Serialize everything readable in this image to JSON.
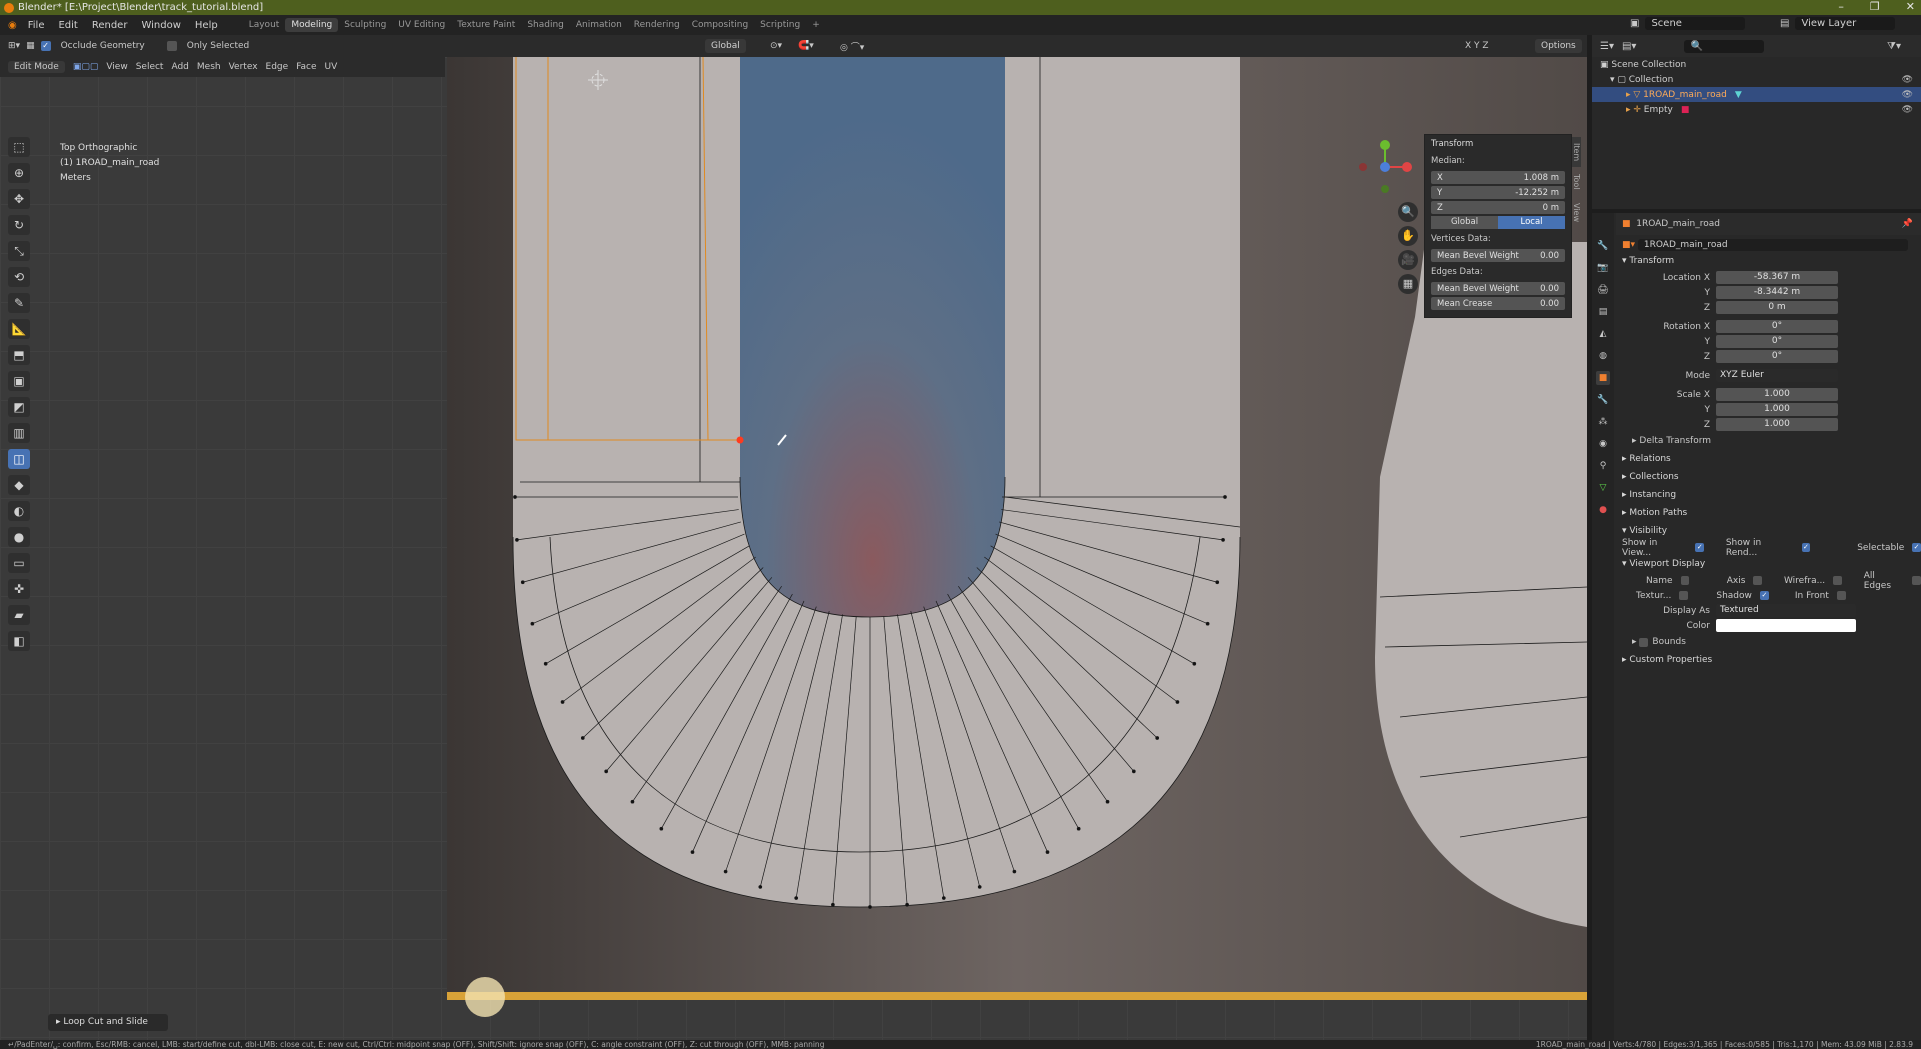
{
  "titlebar": {
    "title": "Blender* [E:\\Project\\Blender\\track_tutorial.blend]",
    "min": "–",
    "max": "❐",
    "close": "✕"
  },
  "menu": {
    "items": [
      "File",
      "Edit",
      "Render",
      "Window",
      "Help"
    ],
    "workspaces": [
      "Layout",
      "Modeling",
      "Sculpting",
      "UV Editing",
      "Texture Paint",
      "Shading",
      "Animation",
      "Rendering",
      "Compositing",
      "Scripting"
    ],
    "active_workspace": "Modeling",
    "add": "+",
    "scene": "Scene",
    "view_layer": "View Layer"
  },
  "header": {
    "occlude": "Occlude Geometry",
    "only_selected": "Only Selected",
    "orientation": "Global",
    "options": "Options",
    "xyz": "X Y Z"
  },
  "header2": {
    "mode": "Edit Mode",
    "items": [
      "View",
      "Select",
      "Add",
      "Mesh",
      "Vertex",
      "Edge",
      "Face",
      "UV"
    ]
  },
  "viewport": {
    "view": "Top Orthographic",
    "object": "(1) 1ROAD_main_road",
    "units": "Meters"
  },
  "npanel": {
    "title": "Transform",
    "median": "Median:",
    "x_label": "X",
    "x": "1.008 m",
    "y_label": "Y",
    "y": "-12.252 m",
    "z_label": "Z",
    "z": "0 m",
    "global": "Global",
    "local": "Local",
    "vertices_data": "Vertices Data:",
    "v_bevel_label": "Mean Bevel Weight",
    "v_bevel": "0.00",
    "edges_data": "Edges Data:",
    "e_bevel_label": "Mean Bevel Weight",
    "e_bevel": "0.00",
    "crease_label": "Mean Crease",
    "crease": "0.00",
    "tabs": [
      "Item",
      "Tool",
      "View"
    ]
  },
  "last_operator": "Loop Cut and Slide",
  "statusbar": {
    "left": "↵/PadEnter/␣: confirm, Esc/RMB: cancel, LMB: start/define cut, dbl-LMB: close cut, E: new cut, Ctrl/Ctrl: midpoint snap (OFF), Shift/Shift: ignore snap (OFF), C: angle constraint (OFF), Z: cut through (OFF), MMB: panning",
    "right": "1ROAD_main_road | Verts:4/780 | Edges:3/1,365 | Faces:0/585 | Tris:1,170 | Mem: 43.09 MiB | 2.83.9"
  },
  "outliner": {
    "root": "Scene Collection",
    "collection": "Collection",
    "obj1": "1ROAD_main_road",
    "obj2": "Empty"
  },
  "properties": {
    "object_name": "1ROAD_main_road",
    "data_name": "1ROAD_main_road",
    "transform": "Transform",
    "loc_x_label": "Location X",
    "loc_x": "-58.367 m",
    "loc_y_label": "Y",
    "loc_y": "-8.3442 m",
    "loc_z_label": "Z",
    "loc_z": "0 m",
    "rot_x_label": "Rotation X",
    "rot_x": "0°",
    "rot_y_label": "Y",
    "rot_y": "0°",
    "rot_z_label": "Z",
    "rot_z": "0°",
    "mode_label": "Mode",
    "mode": "XYZ Euler",
    "scale_x_label": "Scale X",
    "scale_x": "1.000",
    "scale_y_label": "Y",
    "scale_y": "1.000",
    "scale_z_label": "Z",
    "scale_z": "1.000",
    "delta": "Delta Transform",
    "relations": "Relations",
    "collections": "Collections",
    "instancing": "Instancing",
    "motion_paths": "Motion Paths",
    "visibility": "Visibility",
    "show_viewport": "Show in View...",
    "show_render": "Show in Rend...",
    "selectable": "Selectable",
    "viewport_display": "Viewport Display",
    "name": "Name",
    "axis": "Axis",
    "wireframe": "Wirefra...",
    "all_edges": "All Edges",
    "texture": "Textur...",
    "shadow": "Shadow",
    "in_front": "In Front",
    "display_as_label": "Display As",
    "display_as": "Textured",
    "color_label": "Color",
    "bounds": "Bounds",
    "custom_props": "Custom Properties"
  }
}
